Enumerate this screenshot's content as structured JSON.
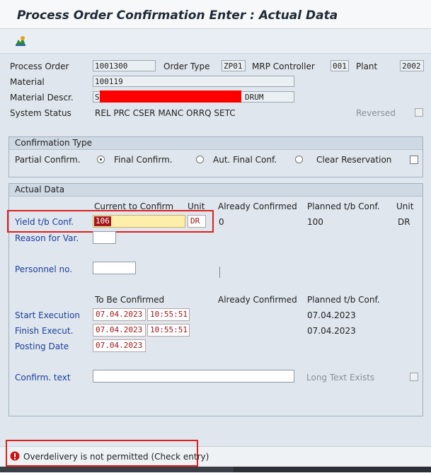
{
  "window": {
    "title": "Process Order Confirmation Enter : Actual Data"
  },
  "header": {
    "process_order_label": "Process Order",
    "process_order_value": "1001300",
    "order_type_label": "Order Type",
    "order_type_value": "ZP01",
    "mrp_controller_label": "MRP Controller",
    "mrp_controller_value": "001",
    "plant_label": "Plant",
    "plant_value": "2002",
    "material_label": "Material",
    "material_value": "100119",
    "material_descr_label": "Material Descr.",
    "material_descr_prefix": "S",
    "material_descr_suffix": "DRUM",
    "system_status_label": "System Status",
    "system_status_value": "REL  PRC  CSER MANC ORRQ SETC",
    "reversed_label": "Reversed"
  },
  "confirmation_type": {
    "title": "Confirmation Type",
    "partial_label": "Partial Confirm.",
    "final_label": "Final Confirm.",
    "aut_final_label": "Aut. Final Conf.",
    "clear_reservation_label": "Clear Reservation",
    "selected": "partial"
  },
  "actual_data": {
    "title": "Actual Data",
    "col_current": "Current to Confirm",
    "col_unit": "Unit",
    "col_already": "Already Confirmed",
    "col_planned": "Planned t/b Conf.",
    "col_unit2": "Unit",
    "yield_label": "Yield t/b Conf.",
    "yield_value": "106",
    "yield_unit": "DR",
    "yield_already": "0",
    "yield_planned": "100",
    "yield_planned_unit": "DR",
    "reason_label": "Reason for Var.",
    "personnel_label": "Personnel no.",
    "to_be_confirmed": "To Be Confirmed",
    "already_confirmed2": "Already Confirmed",
    "planned2": "Planned t/b Conf.",
    "start_label": "Start Execution",
    "start_date": "07.04.2023",
    "start_time": "10:55:51",
    "start_planned": "07.04.2023",
    "finish_label": "Finish Execut.",
    "finish_date": "07.04.2023",
    "finish_time": "10:55:51",
    "finish_planned": "07.04.2023",
    "posting_label": "Posting Date",
    "posting_date": "07.04.2023",
    "confirm_text_label": "Confirm. text",
    "long_text_label": "Long Text Exists"
  },
  "status": {
    "message": "Overdelivery is not permitted (Check entry)"
  },
  "colors": {
    "highlight": "#e0201c",
    "redaction": "#ff0000",
    "error": "#c81414"
  }
}
